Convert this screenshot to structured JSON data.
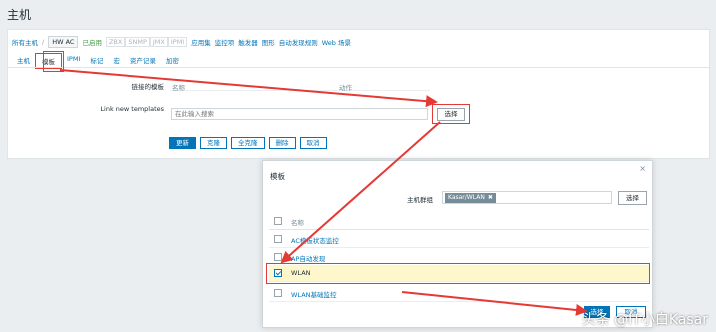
{
  "page": {
    "title": "主机"
  },
  "breadcrumb": {
    "all_hosts": "所有主机",
    "separator": "/",
    "current_host": "HW AC",
    "status": "已启用",
    "badges": [
      "ZBX",
      "SNMP",
      "JMX",
      "IPMI"
    ],
    "links": [
      "应用集",
      "监控项",
      "触发器",
      "图形",
      "自动发现规则",
      "Web 场景"
    ]
  },
  "tabs": [
    "主机",
    "模板",
    "IPMI",
    "标记",
    "宏",
    "资产记录",
    "加密"
  ],
  "form": {
    "linked_templates_label": "链接的模板",
    "col_name": "名称",
    "col_action": "动作",
    "link_new_label": "Link new templates",
    "search_placeholder": "在此输入搜索",
    "select_button": "选择",
    "buttons": [
      "更新",
      "克隆",
      "全克隆",
      "删除",
      "取消"
    ]
  },
  "modal": {
    "title": "模板",
    "close": "×",
    "group_label": "主机群组",
    "group_tag": "Kasar/WLAN",
    "group_tag_remove": "✖",
    "select_button": "选择",
    "column_name": "名称",
    "rows": [
      {
        "name": "AC模板状态监控",
        "checked": false
      },
      {
        "name": "AP自动发现",
        "checked": false
      },
      {
        "name": "WLAN",
        "checked": true
      },
      {
        "name": "WLAN基础监控",
        "checked": false
      }
    ],
    "ok_button": "选择",
    "cancel_button": "取消"
  },
  "watermark": "头条 @IT小白Kasar",
  "colors": {
    "link": "#0275b8",
    "annotation": "#e53935",
    "selected_row": "#fff7cc"
  }
}
